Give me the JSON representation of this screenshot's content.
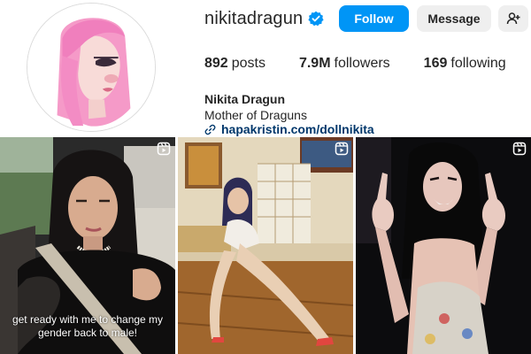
{
  "profile": {
    "username": "nikitadragun",
    "verified_icon": "verified-badge-icon",
    "full_name": "Nikita Dragun",
    "bio": "Mother of Draguns",
    "link": "hapakristin.com/dollnikita",
    "link_icon": "link-icon"
  },
  "actions": {
    "follow_label": "Follow",
    "message_label": "Message",
    "add_user_icon": "add-user-icon"
  },
  "stats": {
    "posts_count": "892",
    "posts_label": "posts",
    "followers_count": "7.9M",
    "followers_label": "followers",
    "following_count": "169",
    "following_label": "following"
  },
  "posts": [
    {
      "type": "reel",
      "caption": "get ready with me to change my gender back to male!"
    },
    {
      "type": "reel",
      "caption": ""
    },
    {
      "type": "reel",
      "caption": ""
    }
  ],
  "colors": {
    "accent": "#0095f6",
    "secondary_button": "#efefef",
    "link": "#00376b",
    "verified": "#0095f6"
  }
}
